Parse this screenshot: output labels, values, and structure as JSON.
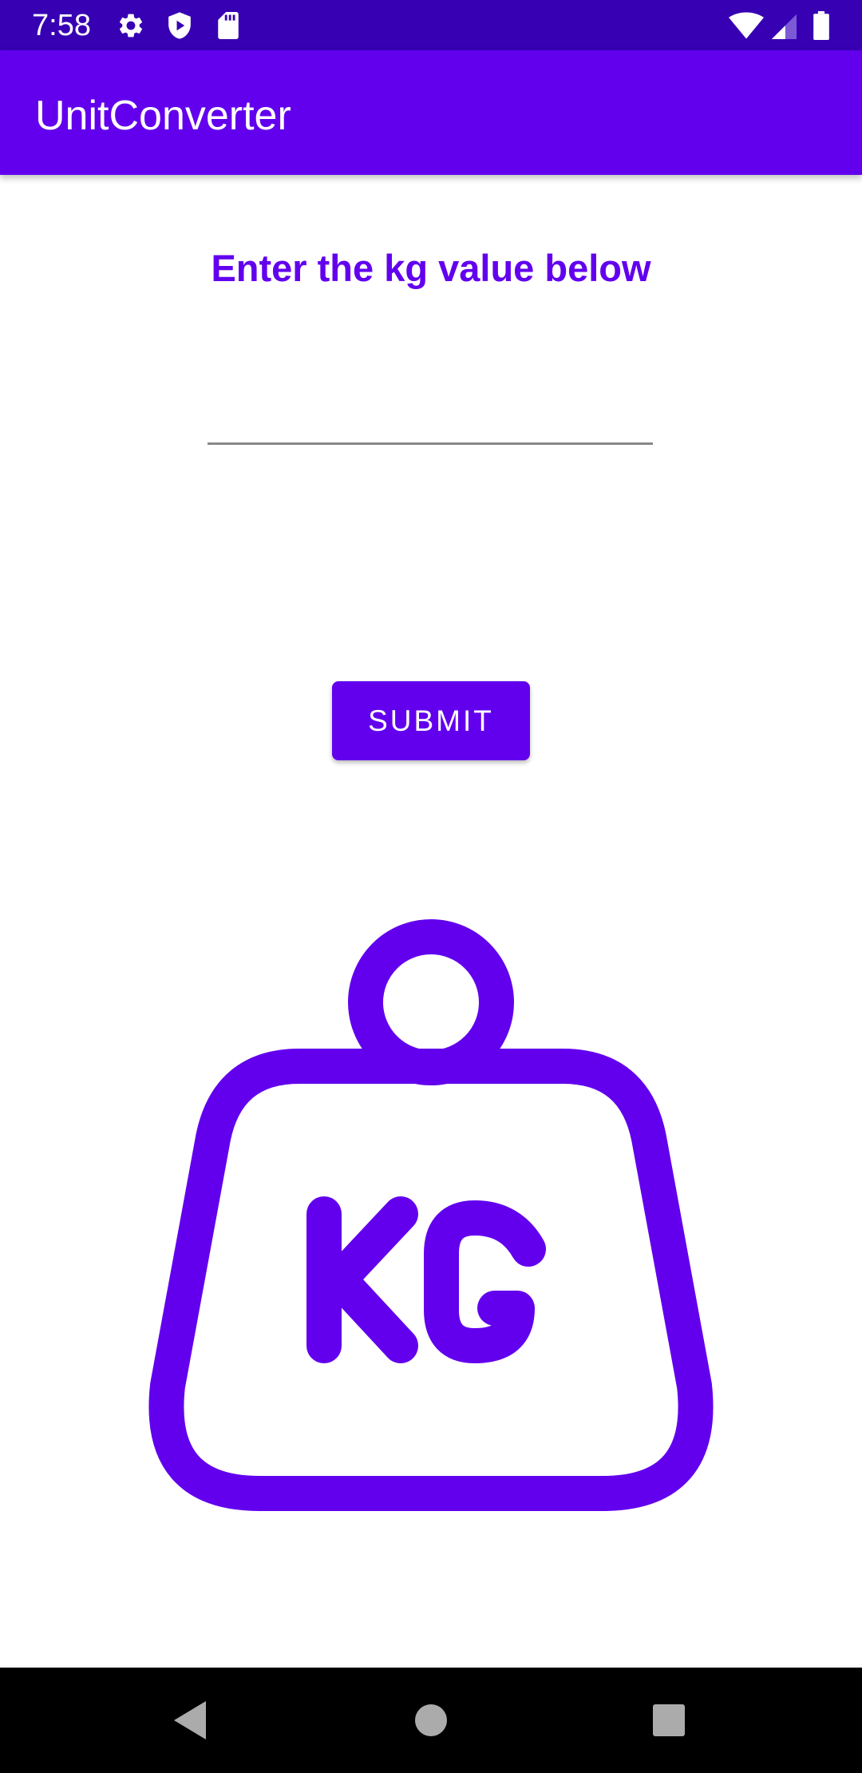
{
  "status_bar": {
    "time": "7:58",
    "left_icons": [
      "settings-icon",
      "play-protect-icon",
      "sd-card-icon"
    ],
    "right_icons": [
      "wifi-icon",
      "cell-signal-icon",
      "battery-icon"
    ]
  },
  "app_bar": {
    "title": "UnitConverter"
  },
  "main": {
    "prompt_label": "Enter the kg value below",
    "kg_input": {
      "value": "",
      "placeholder": ""
    },
    "submit_label": "SUBMIT",
    "illustration": {
      "icon": "kg-weight-icon",
      "text": "KG"
    }
  },
  "nav_bar": {
    "buttons": [
      "back-icon",
      "home-icon",
      "recents-icon"
    ]
  },
  "colors": {
    "primary": "#6200ee",
    "primary_dark": "#3700b3",
    "background": "#ffffff",
    "nav_bar": "#000000"
  }
}
